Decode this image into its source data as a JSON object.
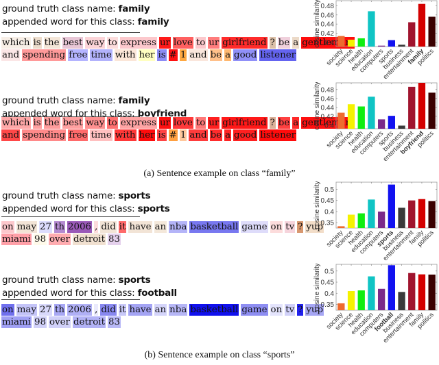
{
  "panels": [
    {
      "ground_truth_label": "ground truth class name: ",
      "ground_truth_class": "family",
      "appended_label": "appended word for this class: ",
      "appended_word": "family",
      "lines": [
        [
          [
            "which",
            "#f7eee6"
          ],
          [
            "is",
            "#ecdccc"
          ],
          [
            "the",
            "#f4e6d8"
          ],
          [
            "best",
            "#e8c6d6"
          ],
          [
            "way",
            "#fcd4d8"
          ],
          [
            "to",
            "#fcdcdc"
          ],
          [
            "express",
            "#fcc8cc"
          ],
          [
            "ur",
            "#ff1a1a"
          ],
          [
            "love",
            "#ff6060"
          ],
          [
            "to",
            "#fcc8cc"
          ],
          [
            "ur",
            "#ff7c7c"
          ],
          [
            "girlfriend",
            "#ff2b2b"
          ],
          [
            "?",
            "#dcc0a8"
          ],
          [
            "be",
            "#f0d0dc"
          ],
          [
            "a",
            "#ecdac8"
          ],
          [
            "gentlemam",
            "#ff0d0d"
          ]
        ],
        [
          [
            "and",
            "#fbe6e6"
          ],
          [
            "spending",
            "#ff9a9a"
          ],
          [
            "free",
            "#b4b4ff"
          ],
          [
            "time",
            "#b2b2fc"
          ],
          [
            "with",
            "#fbe6d8"
          ],
          [
            "her",
            "#ffffc0"
          ],
          [
            "is",
            "#8c8cf6"
          ],
          [
            "#",
            "#ff1010"
          ],
          [
            "1",
            "#ffa840"
          ],
          [
            "and",
            "#fae6dc"
          ],
          [
            "be",
            "#ffc08a"
          ],
          [
            "a",
            "#ffb870"
          ],
          [
            "good",
            "#9090f8"
          ],
          [
            "listener",
            "#6464f0"
          ]
        ]
      ],
      "chart_data": {
        "type": "bar",
        "ylabel": "cosine similarity",
        "categories": [
          "society",
          "science",
          "health",
          "education",
          "computers",
          "sports",
          "business",
          "entertainment",
          "family",
          "politics"
        ],
        "bold_category": "family",
        "values": [
          0.414,
          0.406,
          0.409,
          0.468,
          0.393,
          0.405,
          0.395,
          0.444,
          0.484,
          0.456
        ],
        "colors": [
          "#ee6b2f",
          "#f5f200",
          "#10ee10",
          "#10c4c4",
          "#7b2a8a",
          "#1212f0",
          "#3a3a3a",
          "#a0142e",
          "#d40000",
          "#3a0000"
        ],
        "ylim": [
          0.391,
          0.491
        ],
        "yticks": [
          0.4,
          0.42,
          0.44,
          0.46,
          0.48
        ],
        "ytick_labels": [
          "0.4",
          "0.42",
          "0.44",
          "0.46",
          "0.48"
        ]
      }
    },
    {
      "ground_truth_label": "ground truth class name: ",
      "ground_truth_class": "family",
      "appended_label": "appended word for this class: ",
      "appended_word": "boyfriend",
      "lines": [
        [
          [
            "which",
            "#ffa8a8"
          ],
          [
            "is",
            "#ffa0a0"
          ],
          [
            "the",
            "#ff9c9c"
          ],
          [
            "best",
            "#ffa0a0"
          ],
          [
            "way",
            "#ff9090"
          ],
          [
            "to",
            "#ff7070"
          ],
          [
            "express",
            "#ffa4a4"
          ],
          [
            "ur",
            "#ff1010"
          ],
          [
            "love",
            "#ff3a3a"
          ],
          [
            "to",
            "#ff7878"
          ],
          [
            "ur",
            "#ff2020"
          ],
          [
            "girlfriend",
            "#ff1818"
          ],
          [
            "?",
            "#dcb098"
          ],
          [
            "be",
            "#ff4040"
          ],
          [
            "a",
            "#ff2828"
          ],
          [
            "gentlemam",
            "#ff1010"
          ]
        ],
        [
          [
            "and",
            "#ff4848"
          ],
          [
            "spending",
            "#ff8a8a"
          ],
          [
            "free",
            "#ff6a6a"
          ],
          [
            "time",
            "#ffc0c0"
          ],
          [
            "with",
            "#ff3838"
          ],
          [
            "her",
            "#ff0c0c"
          ],
          [
            "is",
            "#ff4444"
          ],
          [
            "#",
            "#ffa040"
          ],
          [
            "1",
            "#ffc89c"
          ],
          [
            "and",
            "#ff3c3c"
          ],
          [
            "be",
            "#ff2c2c"
          ],
          [
            "a",
            "#ff2424"
          ],
          [
            "good",
            "#ff2020"
          ],
          [
            "listener",
            "#ff0c0c"
          ]
        ]
      ],
      "chart_data": {
        "type": "bar",
        "ylabel": "cosine similarity",
        "categories": [
          "society",
          "science",
          "health",
          "education",
          "computers",
          "sports",
          "business",
          "entertainment",
          "boyfriend",
          "politics"
        ],
        "bold_category": "boyfriend",
        "values": [
          0.428,
          0.447,
          0.442,
          0.464,
          0.413,
          0.421,
          0.399,
          0.486,
          0.495,
          0.473
        ],
        "colors": [
          "#ee6b2f",
          "#f5f200",
          "#10ee10",
          "#10c4c4",
          "#7b2a8a",
          "#1212f0",
          "#3a3a3a",
          "#a0142e",
          "#d40000",
          "#3a0000"
        ],
        "ylim": [
          0.392,
          0.495
        ],
        "yticks": [
          0.4,
          0.42,
          0.44,
          0.46,
          0.48
        ],
        "ytick_labels": [
          "0.4",
          "0.42",
          "0.44",
          "0.46",
          "0.48"
        ]
      }
    },
    {
      "ground_truth_label": "ground truth class name: ",
      "ground_truth_class": "sports",
      "appended_label": "appended word for this class: ",
      "appended_word": "sports",
      "lines": [
        [
          [
            "on",
            "#fcc8cc"
          ],
          [
            "may",
            "#f2e4d6"
          ],
          [
            "27",
            "#dcdcfc"
          ],
          [
            "th",
            "#b48ad0"
          ],
          [
            "2006",
            "#9a5ab8"
          ],
          [
            ",",
            "#fcdcdc"
          ],
          [
            "did",
            "#f2e4d6"
          ],
          [
            "it",
            "#ff6a6a"
          ],
          [
            "have",
            "#f2e4d6"
          ],
          [
            "an",
            "#f4e8da"
          ],
          [
            "nba",
            "#b4b4f8"
          ],
          [
            "basketball",
            "#7878f0"
          ],
          [
            "game",
            "#dedcfa"
          ],
          [
            "on",
            "#fcdcdc"
          ],
          [
            "tv",
            "#f6d4dc"
          ],
          [
            "?",
            "#d89870"
          ],
          [
            "yup",
            "#f2ddc8"
          ]
        ],
        [
          [
            "miami",
            "#ffa0a8"
          ],
          [
            "98",
            "#fffaea"
          ],
          [
            "over",
            "#ffacb0"
          ],
          [
            "detroit",
            "#f0e0d0"
          ],
          [
            "83",
            "#e4d0ec"
          ]
        ]
      ],
      "chart_data": {
        "type": "bar",
        "ylabel": "cosine similarity",
        "categories": [
          "society",
          "science",
          "health",
          "education",
          "computers",
          "sports",
          "business",
          "entertainment",
          "family",
          "politics"
        ],
        "bold_category": "sports",
        "values": [
          0.334,
          0.386,
          0.392,
          0.454,
          0.4,
          0.521,
          0.417,
          0.45,
          0.456,
          0.447
        ],
        "colors": [
          "#ee6b2f",
          "#f5f200",
          "#10ee10",
          "#10c4c4",
          "#7b2a8a",
          "#1212f0",
          "#3a3a3a",
          "#a0142e",
          "#d40000",
          "#3a0000"
        ],
        "ylim": [
          0.326,
          0.532
        ],
        "yticks": [
          0.35,
          0.4,
          0.45,
          0.5
        ],
        "ytick_labels": [
          "0.35",
          "0.4",
          "0.45",
          "0.5"
        ]
      }
    },
    {
      "ground_truth_label": "ground truth class name: ",
      "ground_truth_class": "sports",
      "appended_label": "appended word for this class: ",
      "appended_word": "football",
      "lines": [
        [
          [
            "on",
            "#7070ee"
          ],
          [
            "may",
            "#c4c4f8"
          ],
          [
            "27",
            "#d8d8fa"
          ],
          [
            "th",
            "#a8a8f4"
          ],
          [
            "2006",
            "#b0b0f6"
          ],
          [
            ",",
            "#eaeafc"
          ],
          [
            "did",
            "#8888f0"
          ],
          [
            "it",
            "#c8c8f8"
          ],
          [
            "have",
            "#a4a4f4"
          ],
          [
            "an",
            "#d4d4fa"
          ],
          [
            "nba",
            "#b6b6f6"
          ],
          [
            "basketball",
            "#1010ee"
          ],
          [
            "game",
            "#8e8ef2"
          ],
          [
            "on",
            "#e4e4fc"
          ],
          [
            "tv",
            "#d0d0f8"
          ],
          [
            "?",
            "#2020ee"
          ],
          [
            "yup",
            "#a6a6f4"
          ]
        ],
        [
          [
            "miami",
            "#a0a0f4"
          ],
          [
            "98",
            "#d0d0f8"
          ],
          [
            "over",
            "#d0d0f8"
          ],
          [
            "detroit",
            "#b2b2f6"
          ],
          [
            "83",
            "#b8b8f6"
          ]
        ]
      ],
      "chart_data": {
        "type": "bar",
        "ylabel": "cosine similarity",
        "categories": [
          "society",
          "science",
          "health",
          "education",
          "computers",
          "football",
          "business",
          "entertainment",
          "family",
          "politics"
        ],
        "bold_category": "football",
        "values": [
          0.355,
          0.41,
          0.413,
          0.476,
          0.42,
          0.526,
          0.406,
          0.491,
          0.485,
          0.484
        ],
        "colors": [
          "#ee6b2f",
          "#f5f200",
          "#10ee10",
          "#10c4c4",
          "#7b2a8a",
          "#1212f0",
          "#3a3a3a",
          "#a0142e",
          "#d40000",
          "#3a0000"
        ],
        "ylim": [
          0.324,
          0.53
        ],
        "yticks": [
          0.35,
          0.4,
          0.45,
          0.5
        ],
        "ytick_labels": [
          "0.35",
          "0.4",
          "0.45",
          "0.5"
        ]
      }
    }
  ],
  "captions": {
    "a": "(a) Sentence example on class “family”",
    "b": "(b) Sentence example on class “sports”"
  }
}
